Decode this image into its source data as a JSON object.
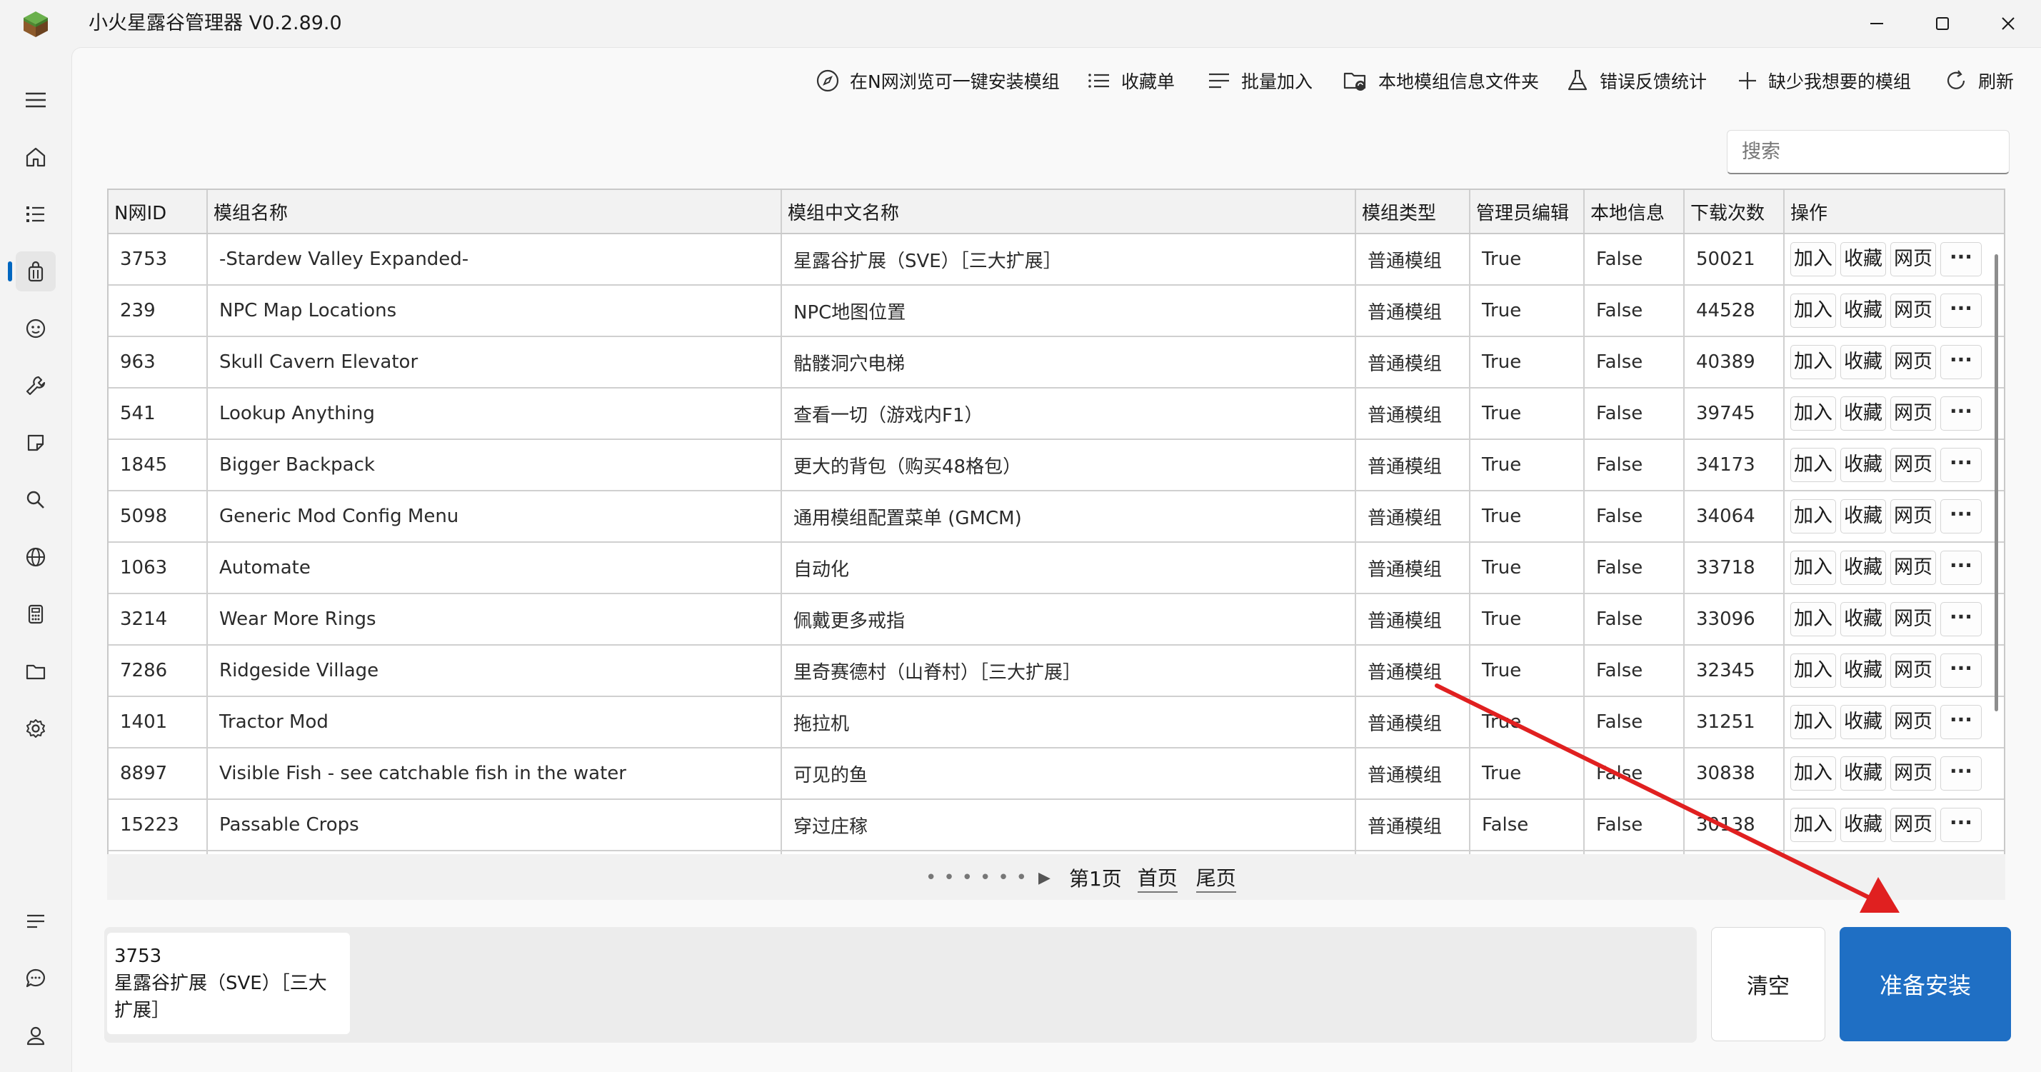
{
  "window": {
    "title": "小火星露谷管理器 V0.2.89.0"
  },
  "toolbar": [
    {
      "label": "在N网浏览可一键安装模组",
      "icon": "compass-icon"
    },
    {
      "label": "收藏单",
      "icon": "list-icon"
    },
    {
      "label": "批量加入",
      "icon": "batch-list-icon"
    },
    {
      "label": "本地模组信息文件夹",
      "icon": "folder-sync-icon"
    },
    {
      "label": "错误反馈统计",
      "icon": "flask-icon"
    },
    {
      "label": "缺少我想要的模组",
      "icon": "plus-icon"
    },
    {
      "label": "刷新",
      "icon": "refresh-icon"
    }
  ],
  "search": {
    "placeholder": "搜索"
  },
  "table": {
    "columns": [
      "N网ID",
      "模组名称",
      "模组中文名称",
      "模组类型",
      "管理员编辑",
      "本地信息",
      "下载次数",
      "操作"
    ],
    "actions": {
      "add": "加入",
      "favorite": "收藏",
      "web": "网页",
      "more": "···"
    },
    "rows": [
      [
        "3753",
        "-Stardew Valley Expanded-",
        "星露谷扩展（SVE）［三大扩展］",
        "普通模组",
        "True",
        "False",
        "50021"
      ],
      [
        "239",
        "NPC Map Locations",
        "NPC地图位置",
        "普通模组",
        "True",
        "False",
        "44528"
      ],
      [
        "963",
        "Skull Cavern Elevator",
        "骷髅洞穴电梯",
        "普通模组",
        "True",
        "False",
        "40389"
      ],
      [
        "541",
        "Lookup Anything",
        "查看一切（游戏内F1）",
        "普通模组",
        "True",
        "False",
        "39745"
      ],
      [
        "1845",
        "Bigger Backpack",
        "更大的背包（购买48格包）",
        "普通模组",
        "True",
        "False",
        "34173"
      ],
      [
        "5098",
        "Generic Mod Config Menu",
        "通用模组配置菜单 (GMCM)",
        "普通模组",
        "True",
        "False",
        "34064"
      ],
      [
        "1063",
        "Automate",
        "自动化",
        "普通模组",
        "True",
        "False",
        "33718"
      ],
      [
        "3214",
        "Wear More Rings",
        "佩戴更多戒指",
        "普通模组",
        "True",
        "False",
        "33096"
      ],
      [
        "7286",
        "Ridgeside Village",
        "里奇赛德村（山脊村）［三大扩展］",
        "普通模组",
        "True",
        "False",
        "32345"
      ],
      [
        "1401",
        "Tractor Mod",
        "拖拉机",
        "普通模组",
        "True",
        "False",
        "31251"
      ],
      [
        "8897",
        "Visible Fish - see catchable fish in the water",
        "可见的鱼",
        "普通模组",
        "True",
        "False",
        "30838"
      ],
      [
        "15223",
        "Passable Crops",
        "穿过庄稼",
        "普通模组",
        "False",
        "False",
        "30138"
      ],
      [
        "",
        "",
        "",
        "",
        "",
        "",
        ""
      ]
    ]
  },
  "pager": {
    "current": "第1页",
    "first": "首页",
    "last": "尾页"
  },
  "selection": {
    "text": "3753\n星露谷扩展（SVE）［三大扩展］"
  },
  "bottom": {
    "clear": "清空",
    "install": "准备安装"
  },
  "colors": {
    "accent": "#1f6fc4",
    "arrow": "#e02020"
  }
}
